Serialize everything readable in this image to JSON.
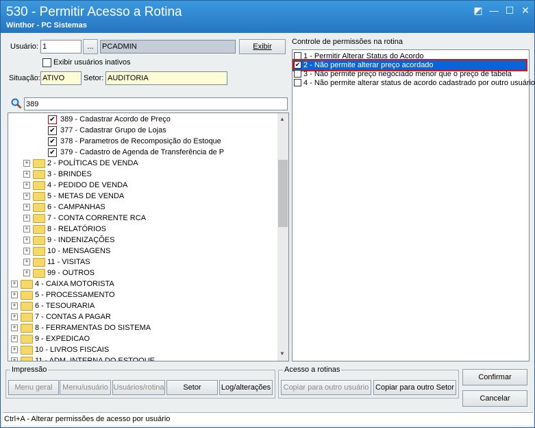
{
  "window": {
    "title": "530 - Permitir Acesso a Rotina",
    "subtitle": "Winthor - PC Sistemas",
    "controls": [
      "◩",
      "—",
      "☐",
      "✕"
    ]
  },
  "user": {
    "label": "Usuário:",
    "id_value": "1",
    "browse_label": "...",
    "name_value": "PCADMIN",
    "exibir_label": "Exibir",
    "inactive_label": "Exibir usuários inativos"
  },
  "situacao": {
    "label": "Situação:",
    "value": "ATIVO"
  },
  "setor": {
    "label": "Setor:",
    "value": "AUDITORIA"
  },
  "search": {
    "value": "389"
  },
  "tree": [
    {
      "label": "389 - Cadastrar Acordo de Preço",
      "checked": true
    },
    {
      "label": "377 - Cadastrar Grupo de Lojas",
      "checked": true
    },
    {
      "label": "378 - Parametros de Recomposição do Estoque",
      "checked": true
    },
    {
      "label": "379 - Cadastro de Agenda de Transferência de P",
      "checked": true
    },
    {
      "label": "2 - POLÍTICAS DE VENDA"
    },
    {
      "label": "3 - BRINDES"
    },
    {
      "label": "4 - PEDIDO DE VENDA"
    },
    {
      "label": "5 - METAS DE VENDA"
    },
    {
      "label": "6 - CAMPANHAS"
    },
    {
      "label": "7 - CONTA CORRENTE RCA"
    },
    {
      "label": "8 - RELATÓRIOS"
    },
    {
      "label": "9 - INDENIZAÇÕES"
    },
    {
      "label": "10 - MENSAGENS"
    },
    {
      "label": "11 - VISITAS"
    },
    {
      "label": "99 - OUTROS"
    },
    {
      "label": "4 - CAIXA MOTORISTA"
    },
    {
      "label": "5 - PROCESSAMENTO"
    },
    {
      "label": "6 - TESOURARIA"
    },
    {
      "label": "7 - CONTAS A PAGAR"
    },
    {
      "label": "8 - FERRAMENTAS DO SISTEMA"
    },
    {
      "label": "9 - EXPEDICAO"
    },
    {
      "label": "10 - LIVROS FISCAIS"
    },
    {
      "label": "11 - ADM. INTERNA DO ESTOQUE"
    }
  ],
  "permissions": {
    "title": "Controle de permissões na rotina",
    "items": [
      {
        "label": "1 - Permitir Alterar Status do Acordo",
        "checked": false
      },
      {
        "label": "2 - Não permite alterar preço acordado",
        "checked": true
      },
      {
        "label": "3 - Não permite preço negociado menor que o preço de tabela",
        "checked": false
      },
      {
        "label": "4 - Não permite alterar status de acordo cadastrado por outro usuário",
        "checked": false
      }
    ]
  },
  "impressao": {
    "title": "Impressão",
    "buttons": [
      "Menu geral",
      "Menu/usuário",
      "Usuários/rotina",
      "Setor",
      "Log/alterações"
    ]
  },
  "acesso": {
    "title": "Acesso a rotinas",
    "copy_user": "Copiar para outro usuário",
    "copy_setor": "Copiar para outro Setor"
  },
  "actions": {
    "confirm": "Confirmar",
    "cancel": "Cancelar"
  },
  "status_text": "Ctrl+A - Alterar permissões de acesso por usuário"
}
